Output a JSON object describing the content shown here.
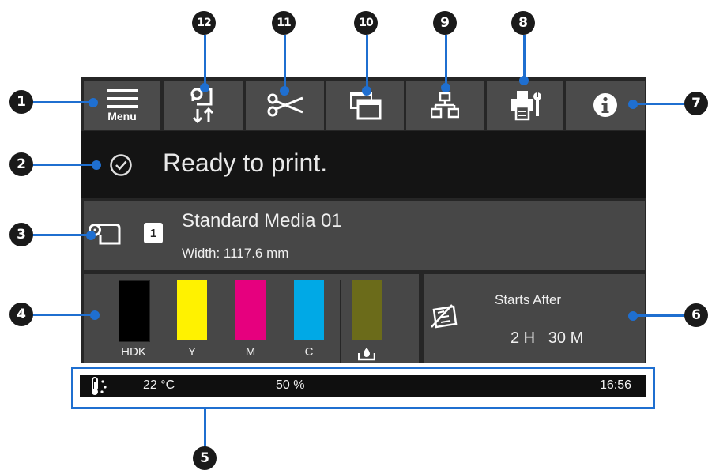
{
  "callouts": [
    "1",
    "2",
    "3",
    "4",
    "5",
    "6",
    "7",
    "8",
    "9",
    "10",
    "11",
    "12"
  ],
  "toolbar": {
    "menu_label": "Menu"
  },
  "status": {
    "message": "Ready to print."
  },
  "media": {
    "slot_number": "1",
    "name": "Standard Media 01",
    "width_label": "Width: 1117.6 mm"
  },
  "inks": [
    {
      "label": "HDK",
      "color": "#000000",
      "level": 1.0
    },
    {
      "label": "Y",
      "color": "#fff200",
      "level": 1.0
    },
    {
      "label": "M",
      "color": "#e6007e",
      "level": 1.0
    },
    {
      "label": "C",
      "color": "#00a9e6",
      "level": 1.0
    },
    {
      "label": "",
      "color": "#6b6b1a",
      "level": 1.0,
      "icon": "waste-ink-icon"
    }
  ],
  "maintenance": {
    "title": "Starts After",
    "time": "2 H   30 M"
  },
  "environment": {
    "temperature": "22 °C",
    "humidity": "50 %",
    "clock": "16:56"
  },
  "colors": {
    "callout_line": "#1f6fd0",
    "panel_bg": "#262626",
    "button_bg": "#4b4b4b"
  }
}
